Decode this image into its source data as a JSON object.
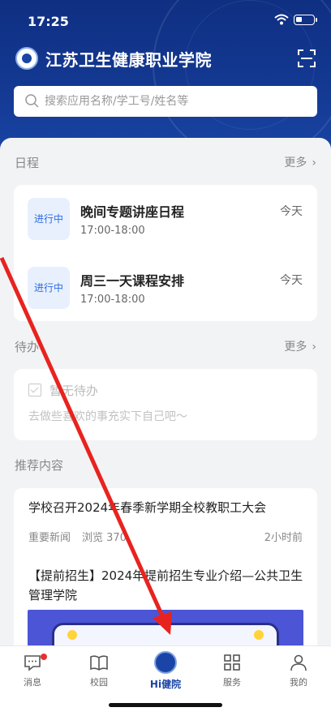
{
  "status_bar": {
    "time": "17:25"
  },
  "header": {
    "title": "江苏卫生健康职业学院",
    "search_placeholder": "搜索应用名称/学工号/姓名等"
  },
  "schedule": {
    "section_title": "日程",
    "more_label": "更多",
    "items": [
      {
        "badge": "进行中",
        "title": "晚间专题讲座日程",
        "time": "17:00-18:00",
        "day": "今天"
      },
      {
        "badge": "进行中",
        "title": "周三一天课程安排",
        "time": "17:00-18:00",
        "day": "今天"
      }
    ]
  },
  "todo": {
    "section_title": "待办",
    "more_label": "更多",
    "empty_text": "暂无待办",
    "sub_text": "去做些喜欢的事充实下自己吧～"
  },
  "recommend": {
    "section_title": "推荐内容",
    "news": [
      {
        "title": "学校召开2024年春季新学期全校教职工大会",
        "category": "重要新闻",
        "views": "浏览 370",
        "time": "2小时前"
      },
      {
        "title": "【提前招生】2024年提前招生专业介绍—公共卫生管理学院"
      }
    ]
  },
  "tabbar": {
    "tabs": [
      {
        "label": "消息",
        "icon": "message-icon"
      },
      {
        "label": "校园",
        "icon": "book-icon"
      },
      {
        "label": "Hi健院",
        "icon": "school-logo-icon"
      },
      {
        "label": "服务",
        "icon": "grid-icon"
      },
      {
        "label": "我的",
        "icon": "user-icon"
      }
    ],
    "active_index": 2
  },
  "colors": {
    "brand": "#1a45a6",
    "badge_text": "#2e6be6",
    "badge_bg": "#e8f0fd",
    "notification_dot": "#e5322d",
    "annotation_arrow": "#e8231f"
  }
}
